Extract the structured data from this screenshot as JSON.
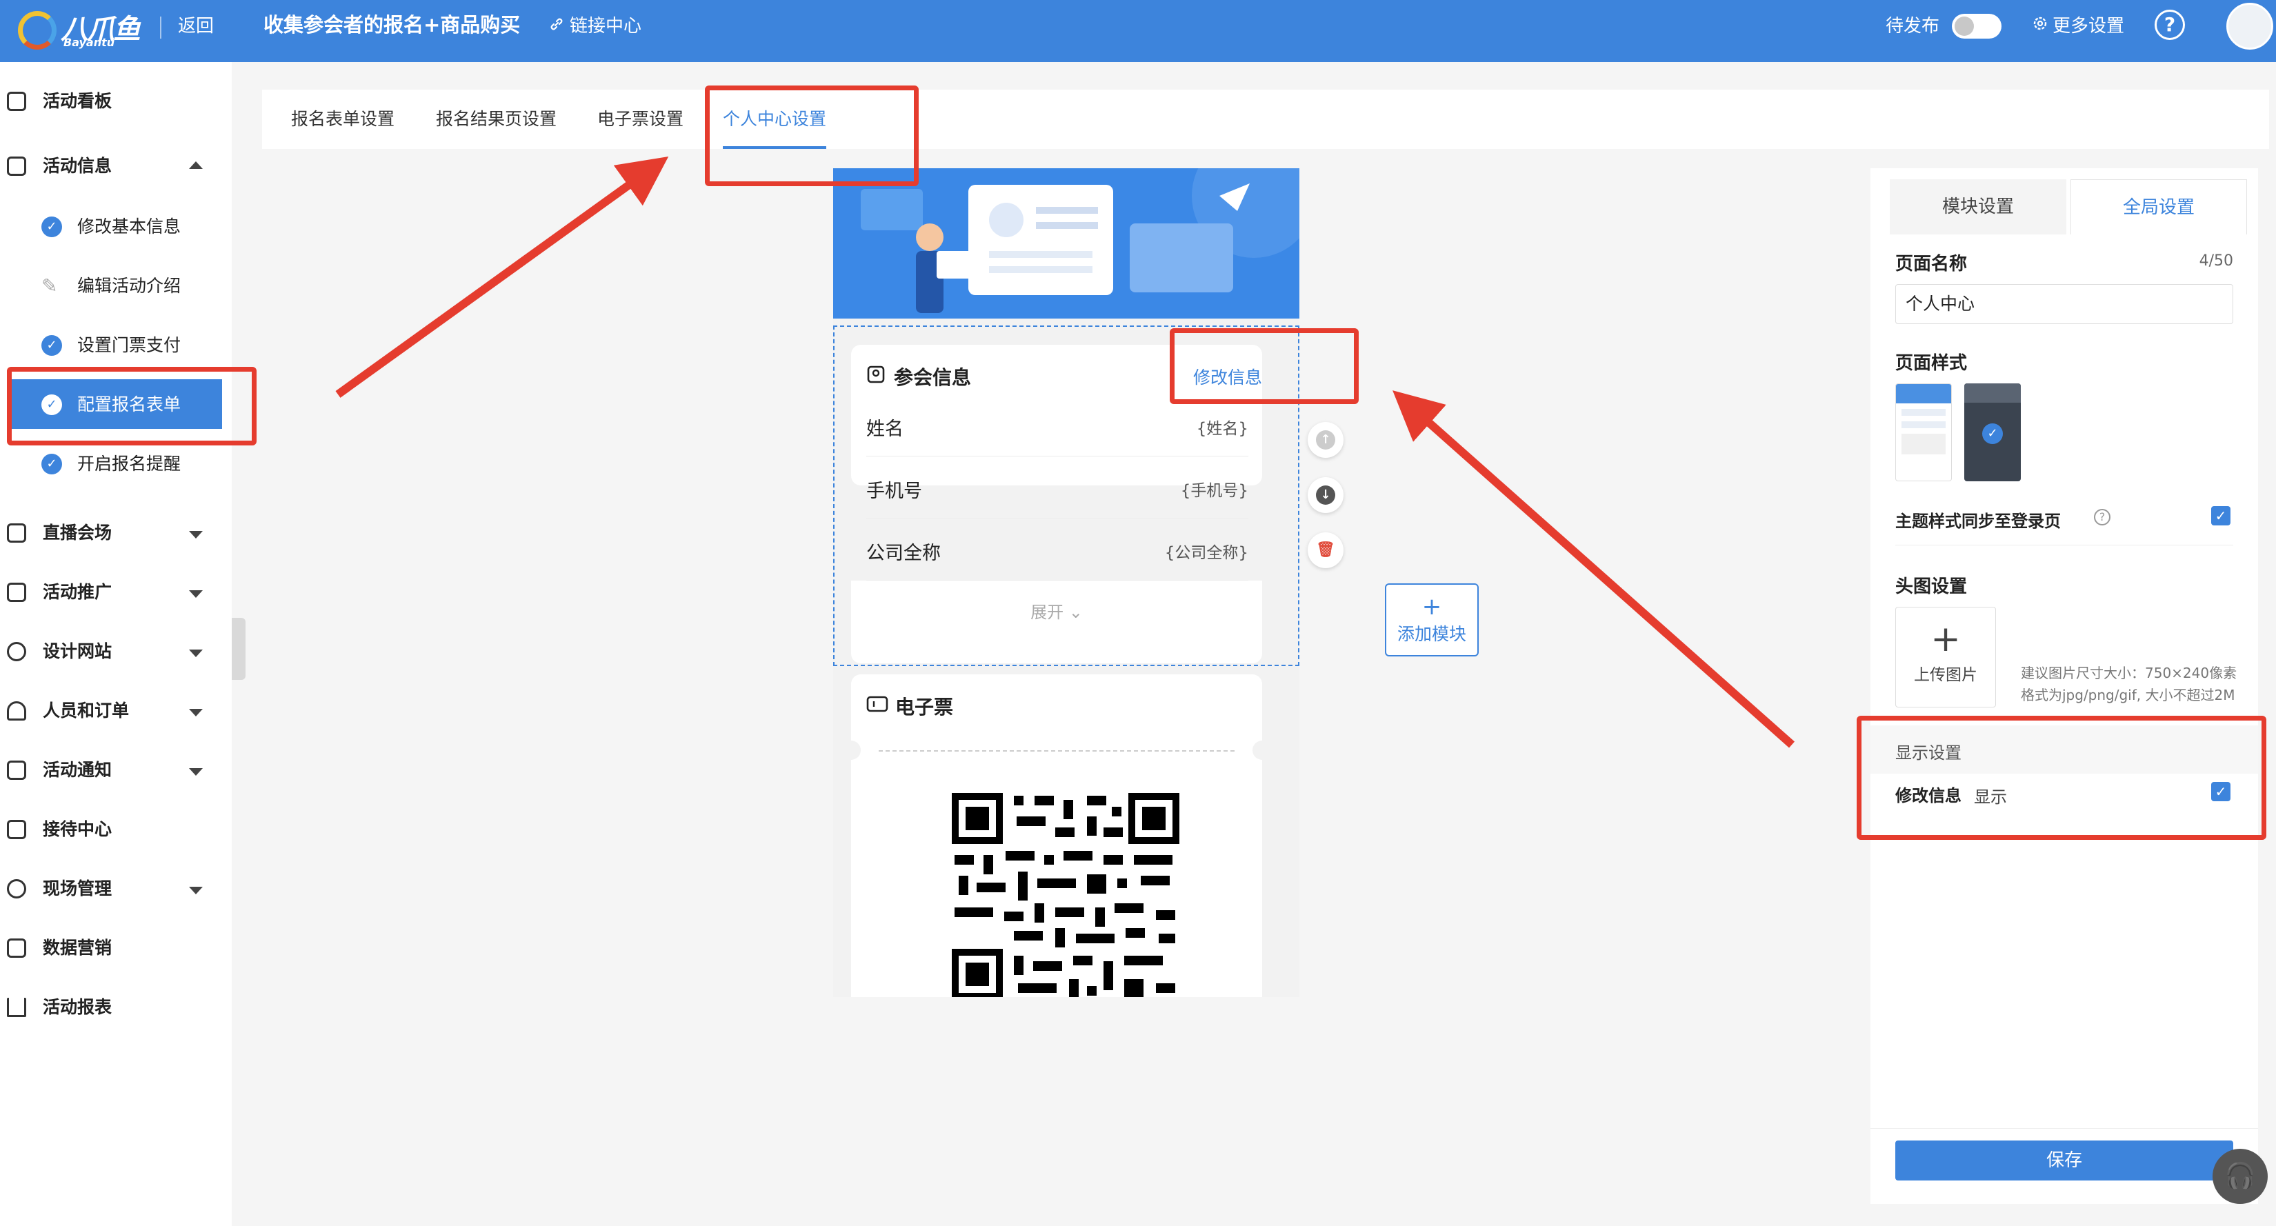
{
  "header": {
    "logo_text": "八爪鱼",
    "logo_sub": "Bayantu",
    "back_label": "返回",
    "title": "收集参会者的报名+商品购买",
    "link_center_label": "链接中心",
    "pending_label": "待发布",
    "more_settings_label": "更多设置",
    "help_label": "?"
  },
  "sidebar": {
    "items": [
      {
        "label": "活动看板",
        "icon": "dashboard-icon"
      },
      {
        "label": "活动信息",
        "icon": "document-icon",
        "expanded": true
      },
      {
        "label": "直播会场",
        "icon": "monitor-icon"
      },
      {
        "label": "活动推广",
        "icon": "cast-icon"
      },
      {
        "label": "设计网站",
        "icon": "compass-icon"
      },
      {
        "label": "人员和订单",
        "icon": "users-icon"
      },
      {
        "label": "活动通知",
        "icon": "message-icon"
      },
      {
        "label": "接待中心",
        "icon": "bag-icon"
      },
      {
        "label": "现场管理",
        "icon": "target-icon"
      },
      {
        "label": "数据营销",
        "icon": "chart-line-icon"
      },
      {
        "label": "活动报表",
        "icon": "bar-chart-icon"
      }
    ],
    "sub_items": [
      {
        "label": "修改基本信息",
        "state": "done"
      },
      {
        "label": "编辑活动介绍",
        "state": "pending"
      },
      {
        "label": "设置门票支付",
        "state": "done"
      },
      {
        "label": "配置报名表单",
        "state": "active"
      },
      {
        "label": "开启报名提醒",
        "state": "done"
      }
    ]
  },
  "tabs": [
    {
      "label": "报名表单设置"
    },
    {
      "label": "报名结果页设置"
    },
    {
      "label": "电子票设置"
    },
    {
      "label": "个人中心设置",
      "active": true
    }
  ],
  "preview": {
    "info_card": {
      "title": "参会信息",
      "edit_label": "修改信息",
      "fields": [
        {
          "label": "姓名",
          "value": "{姓名}"
        },
        {
          "label": "手机号",
          "value": "{手机号}"
        },
        {
          "label": "公司全称",
          "value": "{公司全称}"
        }
      ],
      "expand_label": "展开"
    },
    "ticket_card": {
      "title": "电子票"
    },
    "add_module_label": "添加模块"
  },
  "panel": {
    "tabs": [
      {
        "label": "模块设置"
      },
      {
        "label": "全局设置",
        "active": true
      }
    ],
    "page_name_label": "页面名称",
    "page_name_counter": "4/50",
    "page_name_value": "个人中心",
    "page_style_label": "页面样式",
    "theme_sync_label": "主题样式同步至登录页",
    "header_image_label": "头图设置",
    "upload_label": "上传图片",
    "upload_hint_1": "建议图片尺寸大小：750×240像素",
    "upload_hint_2": "格式为jpg/png/gif, 大小不超过2M",
    "display_settings_label": "显示设置",
    "edit_info_label": "修改信息",
    "show_label": "显示",
    "save_label": "保存"
  },
  "colors": {
    "accent": "#3d84dc",
    "annotation": "#e53c2e"
  }
}
